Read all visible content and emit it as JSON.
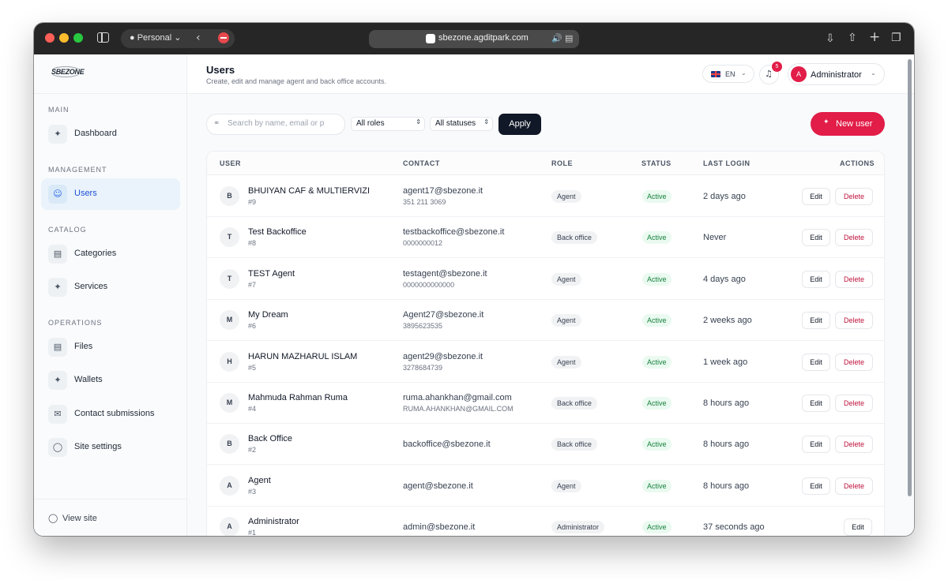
{
  "browser": {
    "profile": "Personal",
    "url": "sbezone.agditpark.com",
    "icons": [
      "sidebar-toggle-icon",
      "person-icon",
      "back-arrow-icon",
      "block-icon",
      "site-favicon",
      "speaker-icon",
      "reader-icon",
      "download-icon",
      "share-icon",
      "plus-icon",
      "tabs-icon"
    ]
  },
  "logo": {
    "text": "SBEZONE"
  },
  "sidebar": {
    "sections": [
      {
        "title": "MAIN",
        "items": [
          {
            "label": "Dashboard",
            "icon": "sparkle-icon",
            "active": false
          }
        ]
      },
      {
        "title": "MANAGEMENT",
        "items": [
          {
            "label": "Users",
            "icon": "users-icon",
            "active": true
          }
        ]
      },
      {
        "title": "CATALOG",
        "items": [
          {
            "label": "Categories",
            "icon": "document-icon",
            "active": false
          },
          {
            "label": "Services",
            "icon": "sparkle-icon",
            "active": false
          }
        ]
      },
      {
        "title": "OPERATIONS",
        "items": [
          {
            "label": "Files",
            "icon": "document-icon",
            "active": false
          },
          {
            "label": "Wallets",
            "icon": "sparkle-icon",
            "active": false
          },
          {
            "label": "Contact submissions",
            "icon": "mail-icon",
            "active": false
          },
          {
            "label": "Site settings",
            "icon": "globe-icon",
            "active": false
          }
        ]
      }
    ],
    "footer": {
      "label": "View site",
      "icon": "globe-icon"
    }
  },
  "header": {
    "title": "Users",
    "subtitle": "Create, edit and manage agent and back office accounts.",
    "language": "EN",
    "notifications": "5",
    "user": {
      "initial": "A",
      "name": "Administrator"
    }
  },
  "filters": {
    "search_placeholder": "Search by name, email or p",
    "role_select": "All roles",
    "status_select": "All statuses",
    "apply_label": "Apply",
    "new_user_label": "New user"
  },
  "table": {
    "columns": [
      "USER",
      "CONTACT",
      "ROLE",
      "STATUS",
      "LAST LOGIN",
      "ACTIONS"
    ],
    "edit_label": "Edit",
    "delete_label": "Delete",
    "rows": [
      {
        "initial": "B",
        "name": "BHUIYAN CAF & MULTIERVIZI",
        "id": "#9",
        "email": "agent17@sbezone.it",
        "phone": "351 211 3069",
        "role": "Agent",
        "status": "Active",
        "last_login": "2 days ago",
        "can_delete": true
      },
      {
        "initial": "T",
        "name": "Test Backoffice",
        "id": "#8",
        "email": "testbackoffice@sbezone.it",
        "phone": "0000000012",
        "role": "Back office",
        "status": "Active",
        "last_login": "Never",
        "can_delete": true
      },
      {
        "initial": "T",
        "name": "TEST Agent",
        "id": "#7",
        "email": "testagent@sbezone.it",
        "phone": "0000000000000",
        "role": "Agent",
        "status": "Active",
        "last_login": "4 days ago",
        "can_delete": true
      },
      {
        "initial": "M",
        "name": "My Dream",
        "id": "#6",
        "email": "Agent27@sbezone.it",
        "phone": "3895623535",
        "role": "Agent",
        "status": "Active",
        "last_login": "2 weeks ago",
        "can_delete": true
      },
      {
        "initial": "H",
        "name": "HARUN MAZHARUL ISLAM",
        "id": "#5",
        "email": "agent29@sbezone.it",
        "phone": "3278684739",
        "role": "Agent",
        "status": "Active",
        "last_login": "1 week ago",
        "can_delete": true
      },
      {
        "initial": "M",
        "name": "Mahmuda Rahman Ruma",
        "id": "#4",
        "email": "ruma.ahankhan@gmail.com",
        "phone": "RUMA.AHANKHAN@GMAIL.COM",
        "role": "Back office",
        "status": "Active",
        "last_login": "8 hours ago",
        "can_delete": true
      },
      {
        "initial": "B",
        "name": "Back Office",
        "id": "#2",
        "email": "backoffice@sbezone.it",
        "phone": "",
        "role": "Back office",
        "status": "Active",
        "last_login": "8 hours ago",
        "can_delete": true
      },
      {
        "initial": "A",
        "name": "Agent",
        "id": "#3",
        "email": "agent@sbezone.it",
        "phone": "",
        "role": "Agent",
        "status": "Active",
        "last_login": "8 hours ago",
        "can_delete": true
      },
      {
        "initial": "A",
        "name": "Administrator",
        "id": "#1",
        "email": "admin@sbezone.it",
        "phone": "",
        "role": "Administrator",
        "status": "Active",
        "last_login": "37 seconds ago",
        "can_delete": false
      }
    ]
  },
  "colors": {
    "accent": "#e11d48",
    "dark_button": "#111827",
    "active_nav": "#eaf3fb",
    "status_green": "#15803d"
  }
}
